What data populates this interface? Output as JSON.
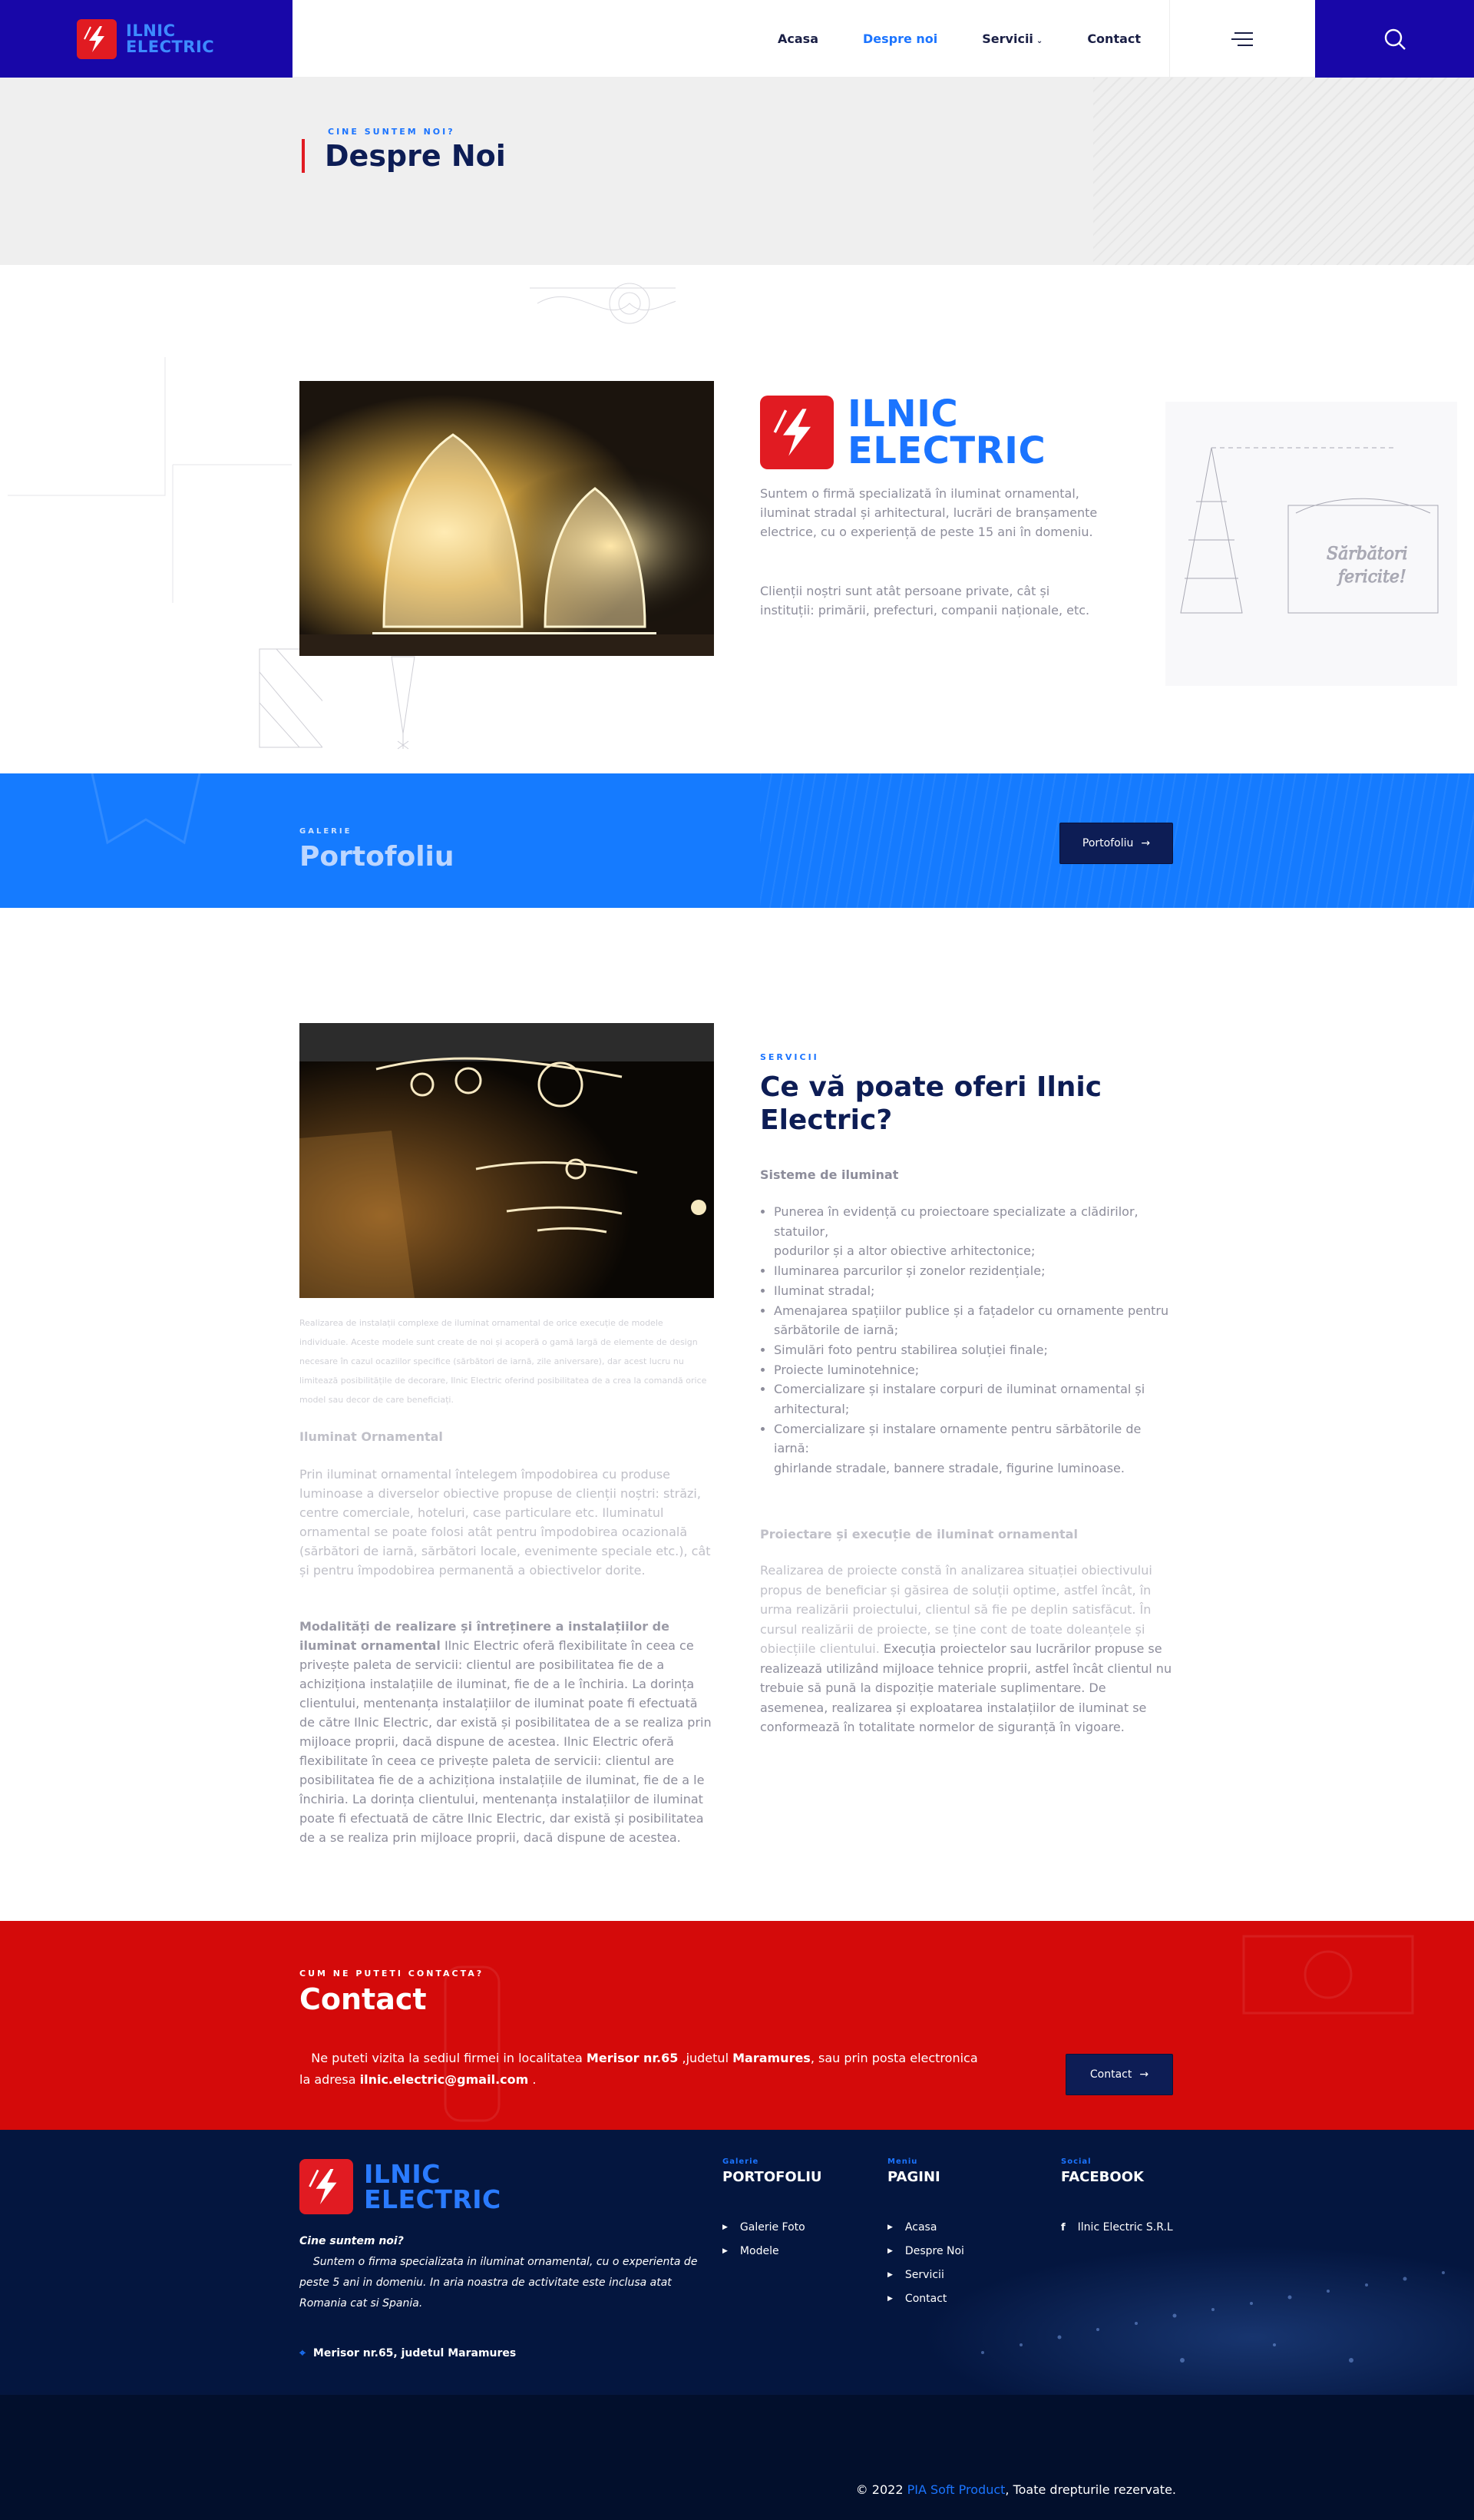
{
  "header": {
    "logo_line1": "ILNIC",
    "logo_line2": "ELECTRIC",
    "nav": [
      {
        "label": "Acasa"
      },
      {
        "label": "Despre noi"
      },
      {
        "label": "Servicii"
      },
      {
        "label": "Contact"
      }
    ],
    "active_nav": "Despre noi",
    "menu_icon": "hamburger-menu-icon",
    "search_icon": "search-icon"
  },
  "page_title": {
    "eyebrow": "CINE SUNTEM NOI?",
    "title": "Despre Noi"
  },
  "about": {
    "logo_line1": "ILNIC",
    "logo_line2": "ELECTRIC",
    "paragraph1": "Suntem o firmă specializată în iluminat ornamental, iluminat stradal și arhitectural, lucrări de branșamente electrice, cu o experiență de peste 15 ani în domeniu.",
    "paragraph2": "Clienții noștri sunt atât persoane private, cât și instituții: primării, prefecturi, companii naționale, etc."
  },
  "portfolio": {
    "eyebrow": "GALERIE",
    "title": "Portofoliu",
    "button": "Portofoliu"
  },
  "services": {
    "eyebrow": "SERVICII",
    "title": "Ce vă poate oferi Ilnic Electric?",
    "subtitle": "Sisteme de iluminat",
    "list": [
      "Punerea în evidență cu proiectoare specializate a clădirilor, statuilor,\npodurilor și a altor obiective arhitectonice;",
      "Iluminarea parcurilor și zonelor rezidențiale;",
      "Iluminat stradal;",
      "Amenajarea spațiilor publice și a fațadelor cu ornamente pentru sărbătorile de iarnă;",
      "Simulări foto pentru stabilirea soluției finale;",
      "Proiecte luminotehnice;",
      "Comercializare și instalare corpuri de iluminat ornamental și arhitectural;",
      "Comercializare și instalare ornamente pentru sărbătorile de iarnă:\nghirlande stradale, bannere stradale, figurine luminoase."
    ],
    "caption": "Realizarea de instalații complexe de iluminat ornamental de orice execuție de modele individuale. Aceste modele sunt create de noi și acoperă o gamă largă de elemente de design necesare în cazul ocaziilor specifice (sărbători de iarnă, zile aniversare), dar acest lucru nu limitează posibilitățile de decorare, Ilnic Electric oferind posibilitatea de a crea la comandă orice model sau decor de care beneficiați.",
    "ornamental_title": "Iluminat Ornamental",
    "ornamental_text": "Prin iluminat ornamental întelegem împodobirea cu produse luminoase a diverselor obiective propuse de clienții noștri: străzi, centre comerciale, hoteluri, case particulare etc. Iluminatul ornamental se poate folosi atât pentru împodobirea ocazională (sărbători de iarnă, sărbători locale, evenimente speciale etc.), cât și pentru împodobirea permanentă a obiectivelor dorite.",
    "modalities_title": "Modalități de realizare și întreținere a instalațiilor de iluminat ornamental",
    "modalities_text": "Ilnic Electric oferă flexibilitate în ceea ce privește paleta de servicii: clientul are posibilitatea fie de a achiziționa instalațiile de iluminat, fie de a le închiria. La dorința clientului, mentenanța instalațiilor de iluminat poate fi efectuată de către Ilnic Electric, dar există și posibilitatea de a se realiza prin mijloace proprii, dacă dispune de acestea. Ilnic Electric oferă flexibilitate în ceea ce privește paleta de servicii: clientul are posibilitatea fie de a achiziționa instalațiile de iluminat, fie de a le închiria. La dorința clientului, mentenanța instalațiilor de iluminat poate fi efectuată de către Ilnic Electric, dar există și posibilitatea de a se realiza prin mijloace proprii, dacă dispune de acestea.",
    "design_title": "Proiectare și execuție de iluminat ornamental",
    "design_text_faded": "Realizarea de proiecte constă în analizarea situației obiectivului propus de beneficiar și găsirea de soluții optime, astfel încât, în urma realizării proiectului, clientul să fie pe deplin satisfăcut. În cursul realizării de proiecte, se ține cont de toate doleanțele și obiecțiile clientului.",
    "design_text": "Execuția proiectelor sau lucrărilor propuse se realizează utilizând mijloace tehnice proprii, astfel încât clientul nu trebuie să pună la dispoziție materiale suplimentare. De asemenea, realizarea și exploatarea instalațiilor de iluminat se conformează în totalitate normelor de siguranță în vigoare."
  },
  "contact": {
    "eyebrow": "CUM NE PUTETI CONTACTA?",
    "title": "Contact",
    "text_before": "Ne puteti vizita la sediul firmei in localitatea ",
    "locality": "Merisor nr.65",
    "text_mid": " ,judetul ",
    "county": "Maramures",
    "text_after": ", sau prin posta electronica la adresa ",
    "email": "ilnic.electric@gmail.com",
    "text_end": " .",
    "button": "Contact"
  },
  "footer": {
    "logo_line1": "ILNIC",
    "logo_line2": "ELECTRIC",
    "about_title": "Cine suntem noi?",
    "about_text": "Suntem o firma specializata in iluminat ornamental, cu o experienta de peste 5 ani in domeniu. In aria noastra de activitate este inclusa atat Romania cat si Spania.",
    "address": "Merisor nr.65, judetul Maramures",
    "columns": [
      {
        "eyebrow": "Galerie",
        "title": "PORTOFOLIU",
        "items": [
          "Galerie Foto",
          "Modele"
        ]
      },
      {
        "eyebrow": "Meniu",
        "title": "PAGINI",
        "items": [
          "Acasa",
          "Despre Noi",
          "Servicii",
          "Contact"
        ]
      },
      {
        "eyebrow": "Social",
        "title": "FACEBOOK",
        "items": [
          "Ilnic Electric S.R.L"
        ]
      }
    ],
    "copyright_pre": "© 2022 ",
    "copyright_brand": "PIA Soft Product",
    "copyright_post": ", Toate drepturile rezervate."
  },
  "colors": {
    "brand_blue": "#1807a8",
    "accent_blue": "#157bff",
    "navy": "#0d1d55",
    "red": "#d40a0a",
    "footer_bg": "#04163f"
  }
}
